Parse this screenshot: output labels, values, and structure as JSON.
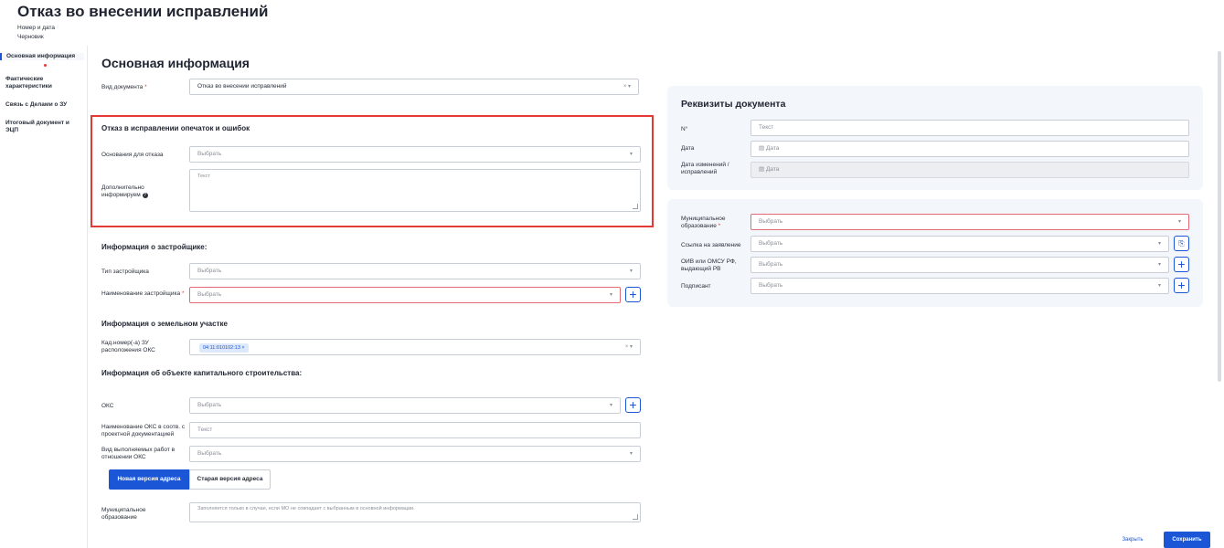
{
  "page": {
    "title": "Отказ во внесении исправлений",
    "meta_number_date": "Номер и дата",
    "meta_status": "Черновик"
  },
  "sidebar": {
    "items": [
      {
        "label": "Основная информация"
      },
      {
        "label": "Фактические характеристики"
      },
      {
        "label": "Связь с Делами о ЗУ"
      },
      {
        "label": "Итоговый документ и ЭЦП"
      }
    ]
  },
  "main": {
    "section_title": "Основная информация",
    "doc_type": {
      "label": "Вид документа",
      "required": "*",
      "value": "Отказ во внесении исправлений",
      "controls": "× ▾"
    },
    "refusal": {
      "title": "Отказ в исправлении опечаток и ошибок",
      "reason_label": "Основания для отказа",
      "reason_placeholder": "Выбрать",
      "extra_label": "Дополнительно информируем",
      "extra_placeholder": "Текст"
    },
    "developer": {
      "title": "Информация о застройщике:",
      "type_label": "Тип застройщика",
      "type_placeholder": "Выбрать",
      "name_label": "Наименование застройщика",
      "name_required": "*",
      "name_placeholder": "Выбрать"
    },
    "land": {
      "title": "Информация о земельном участке",
      "cadastral_label": "Кад.номер(-а) ЗУ расположения ОКС",
      "cadastral_chip": "04:11:010102:13",
      "chip_remove": "×",
      "controls": "× ▾"
    },
    "capital": {
      "title": "Информация об объекте капитального строительства:",
      "oks_label": "ОКС",
      "oks_placeholder": "Выбрать",
      "oks_name_label": "Наименование ОКС в соотв. с проектной документацией",
      "oks_name_placeholder": "Текст",
      "works_label": "Вид выполняемых работ в отношении ОКС",
      "works_placeholder": "Выбрать",
      "tab_new": "Новая версия адреса",
      "tab_old": "Старая версия адреса",
      "mo_label": "Муниципальное образование",
      "mo_placeholder": "Заполняется только в случае, если МО не совпадает с выбранным в основной информации."
    }
  },
  "requisites": {
    "title": "Реквизиты документа",
    "number_label": "N°",
    "number_placeholder": "Текст",
    "date_label": "Дата",
    "date_placeholder": "Дата",
    "changed_label": "Дата изменений / исправлений",
    "changed_placeholder": "Дата"
  },
  "org": {
    "mo_label": "Муниципальное образование",
    "mo_required": "*",
    "mo_placeholder": "Выбрать",
    "link_label": "Ссылка на заявление",
    "link_placeholder": "Выбрать",
    "oiv_label": "ОИВ или ОМСУ РФ, выдающий РВ",
    "oiv_placeholder": "Выбрать",
    "signer_label": "Подписант",
    "signer_placeholder": "Выбрать"
  },
  "footer": {
    "close_label": "Закрыть",
    "save_label": "Сохранить"
  },
  "colors": {
    "accent": "#1a56d6",
    "error": "#e53935",
    "panel": "#f3f6fb"
  }
}
